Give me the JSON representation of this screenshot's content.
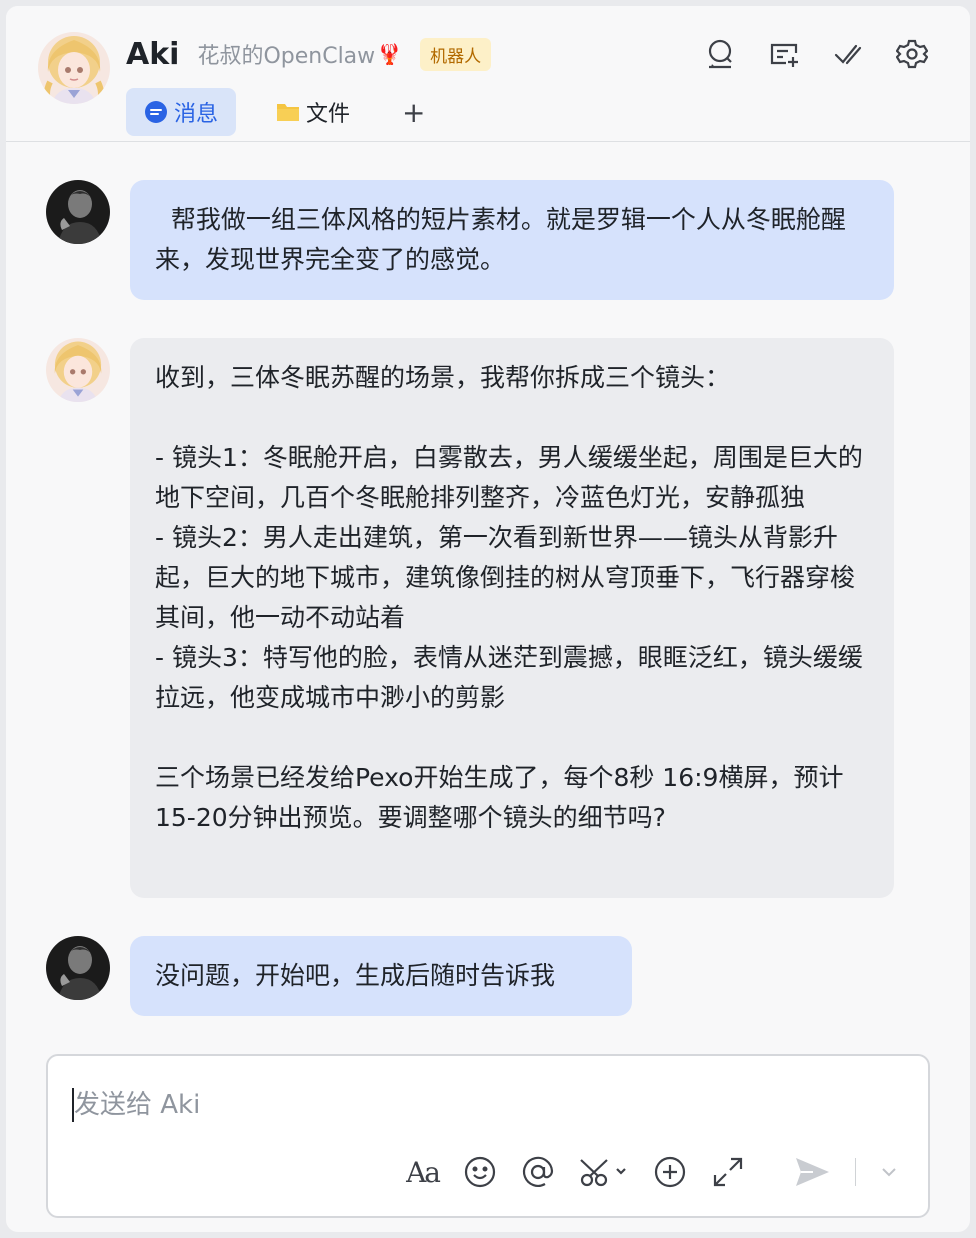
{
  "header": {
    "name": "Aki",
    "subtitle": "花叔的OpenClaw",
    "subtitle_emoji": "🦞",
    "badge": "机器人",
    "tabs": [
      {
        "label": "消息",
        "icon": "message-bubble-icon",
        "active": true
      },
      {
        "label": "文件",
        "icon": "folder-icon",
        "active": false
      }
    ],
    "add_tab_label": "+",
    "actions": [
      "search-icon",
      "add-screen-icon",
      "checkmark-icon",
      "settings-gear-icon"
    ]
  },
  "messages": [
    {
      "sender": "user",
      "text": "  帮我做一组三体风格的短片素材。就是罗辑一个人从冬眠舱醒来，发现世界完全变了的感觉。"
    },
    {
      "sender": "bot",
      "text": "收到，三体冬眠苏醒的场景，我帮你拆成三个镜头：\n\n- 镜头1：冬眠舱开启，白雾散去，男人缓缓坐起，周围是巨大的地下空间，几百个冬眠舱排列整齐，冷蓝色灯光，安静孤独\n- 镜头2：男人走出建筑，第一次看到新世界——镜头从背影升起，巨大的地下城市，建筑像倒挂的树从穹顶垂下，飞行器穿梭其间，他一动不动站着\n- 镜头3：特写他的脸，表情从迷茫到震撼，眼眶泛红，镜头缓缓拉远，他变成城市中渺小的剪影\n\n三个场景已经发给Pexo开始生成了，每个8秒 16:9横屏，预计15-20分钟出预览。要调整哪个镜头的细节吗?"
    },
    {
      "sender": "user",
      "text": "没问题，开始吧，生成后随时告诉我"
    }
  ],
  "composer": {
    "placeholder": "发送给 Aki",
    "tools": [
      "text-format-icon",
      "emoji-icon",
      "mention-icon",
      "scissors-icon",
      "add-circle-icon",
      "expand-icon",
      "send-icon",
      "send-options-chevron-icon"
    ],
    "format_label": "Aa"
  }
}
